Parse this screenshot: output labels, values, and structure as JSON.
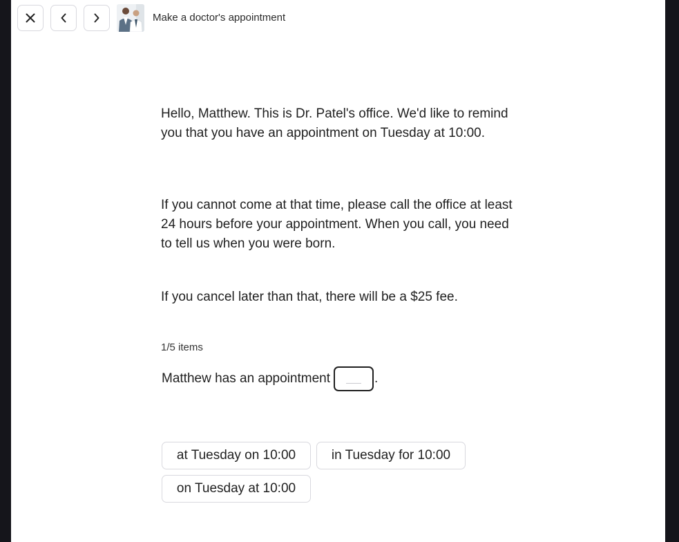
{
  "header": {
    "close_icon": "close-icon",
    "back_icon": "chevron-left-icon",
    "forward_icon": "chevron-right-icon",
    "lesson_title": "Make a doctor's appointment"
  },
  "reading": {
    "paragraphs": [
      "Hello, Matthew. This is Dr. Patel's office. We'd like to remind you that you have an appointment on Tuesday at 10:00.",
      "If you cannot come at that time, please call the office at least 24 hours before your appointment. When you call, you need to tell us when you were born.",
      "If you cancel later than that, there will be a $25 fee."
    ]
  },
  "exercise": {
    "counter": "1/5 items",
    "prompt": "Matthew has an appointment",
    "end_punct": ".",
    "options": [
      "at Tuesday on 10:00",
      "in Tuesday for 10:00",
      "on Tuesday at 10:00"
    ]
  }
}
